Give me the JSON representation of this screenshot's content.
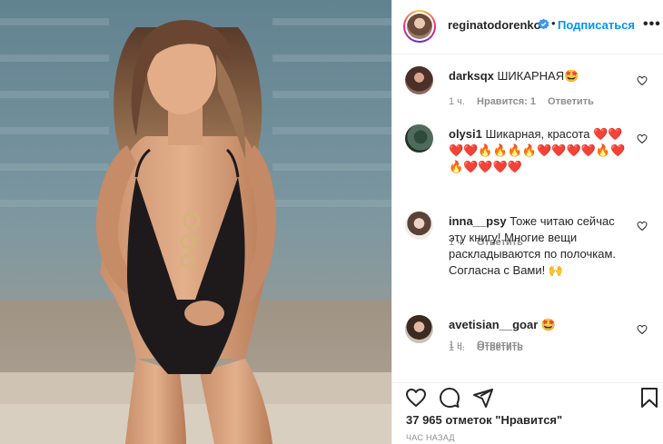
{
  "post": {
    "author": "reginatodorenko",
    "follow_label": "Подписаться",
    "separator": "•",
    "more_glyph": "•••"
  },
  "comments": [
    {
      "user": "darksqx",
      "text": "ШИКАРНАЯ🤩",
      "time": "1 ч.",
      "likes": "Нравится: 1",
      "reply": "Ответить"
    },
    {
      "user": "olysi1",
      "text": "Шикарная, красота ❤️❤️❤️❤️🔥🔥🔥🔥❤️❤️❤️❤️🔥❤️🔥❤️❤️❤️❤️",
      "time": "1 ч.",
      "reply": "Ответить"
    },
    {
      "user": "inna__psy",
      "text": "Тоже читаю сейчас эту книгу! Многие вещи раскладываются по полочкам. Согласна с Вами! 🙌",
      "time": "1 ч.",
      "reply": "Ответить"
    },
    {
      "user": "avetisian__goar",
      "text": "🤩",
      "time": "1 ч.",
      "reply": "Ответить"
    }
  ],
  "footer": {
    "likes": "37 965 отметок \"Нравится\"",
    "time": "ЧАС НАЗАД"
  },
  "colors": {
    "accent": "#0095f6",
    "text": "#262626",
    "muted": "#8e8e8e",
    "border": "#efefef"
  },
  "icons": [
    "verified-badge-icon",
    "more-options-icon",
    "heart-icon",
    "comment-icon",
    "share-icon",
    "bookmark-icon"
  ]
}
